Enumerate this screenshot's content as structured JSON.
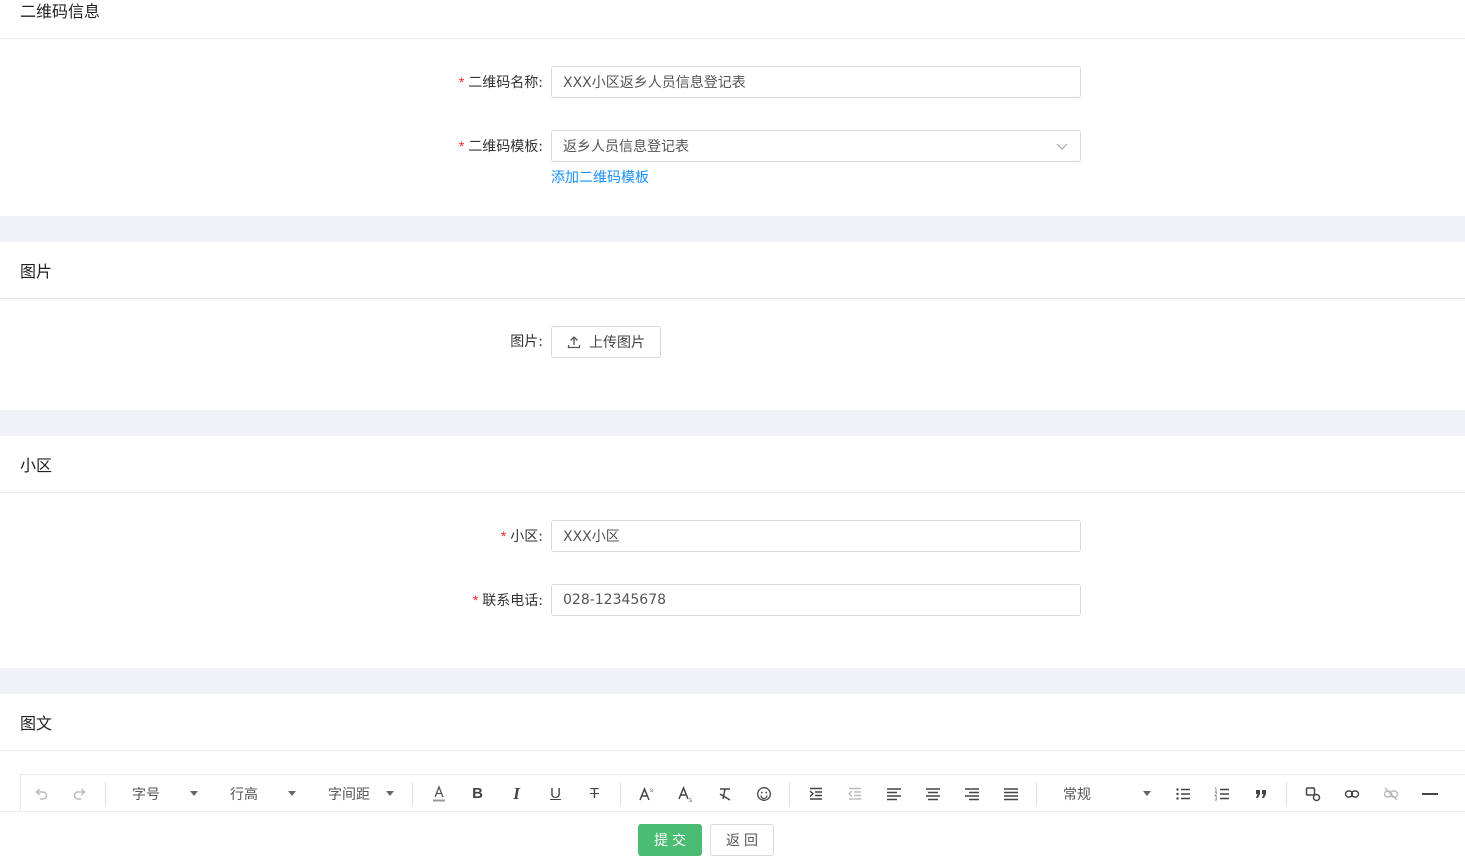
{
  "sections": {
    "qrcode": {
      "title": "二维码信息",
      "name_label": "二维码名称:",
      "name_value": "XXX小区返乡人员信息登记表",
      "template_label": "二维码模板:",
      "template_value": "返乡人员信息登记表",
      "add_template_link": "添加二维码模板"
    },
    "image": {
      "title": "图片",
      "field_label": "图片:",
      "upload_label": "上传图片"
    },
    "community": {
      "title": "小区",
      "community_label": "小区:",
      "community_value": "XXX小区",
      "phone_label": "联系电话:",
      "phone_value": "028-12345678"
    },
    "richtext": {
      "title": "图文",
      "toolbar": {
        "font_size": "字号",
        "line_height": "行高",
        "letter_spacing": "字间距",
        "paragraph": "常规"
      }
    }
  },
  "footer": {
    "submit_label": "提交",
    "back_label": "返回"
  },
  "colors": {
    "primary_green": "#4bbd72",
    "link_blue": "#1890ff",
    "required_red": "#f5222d"
  }
}
